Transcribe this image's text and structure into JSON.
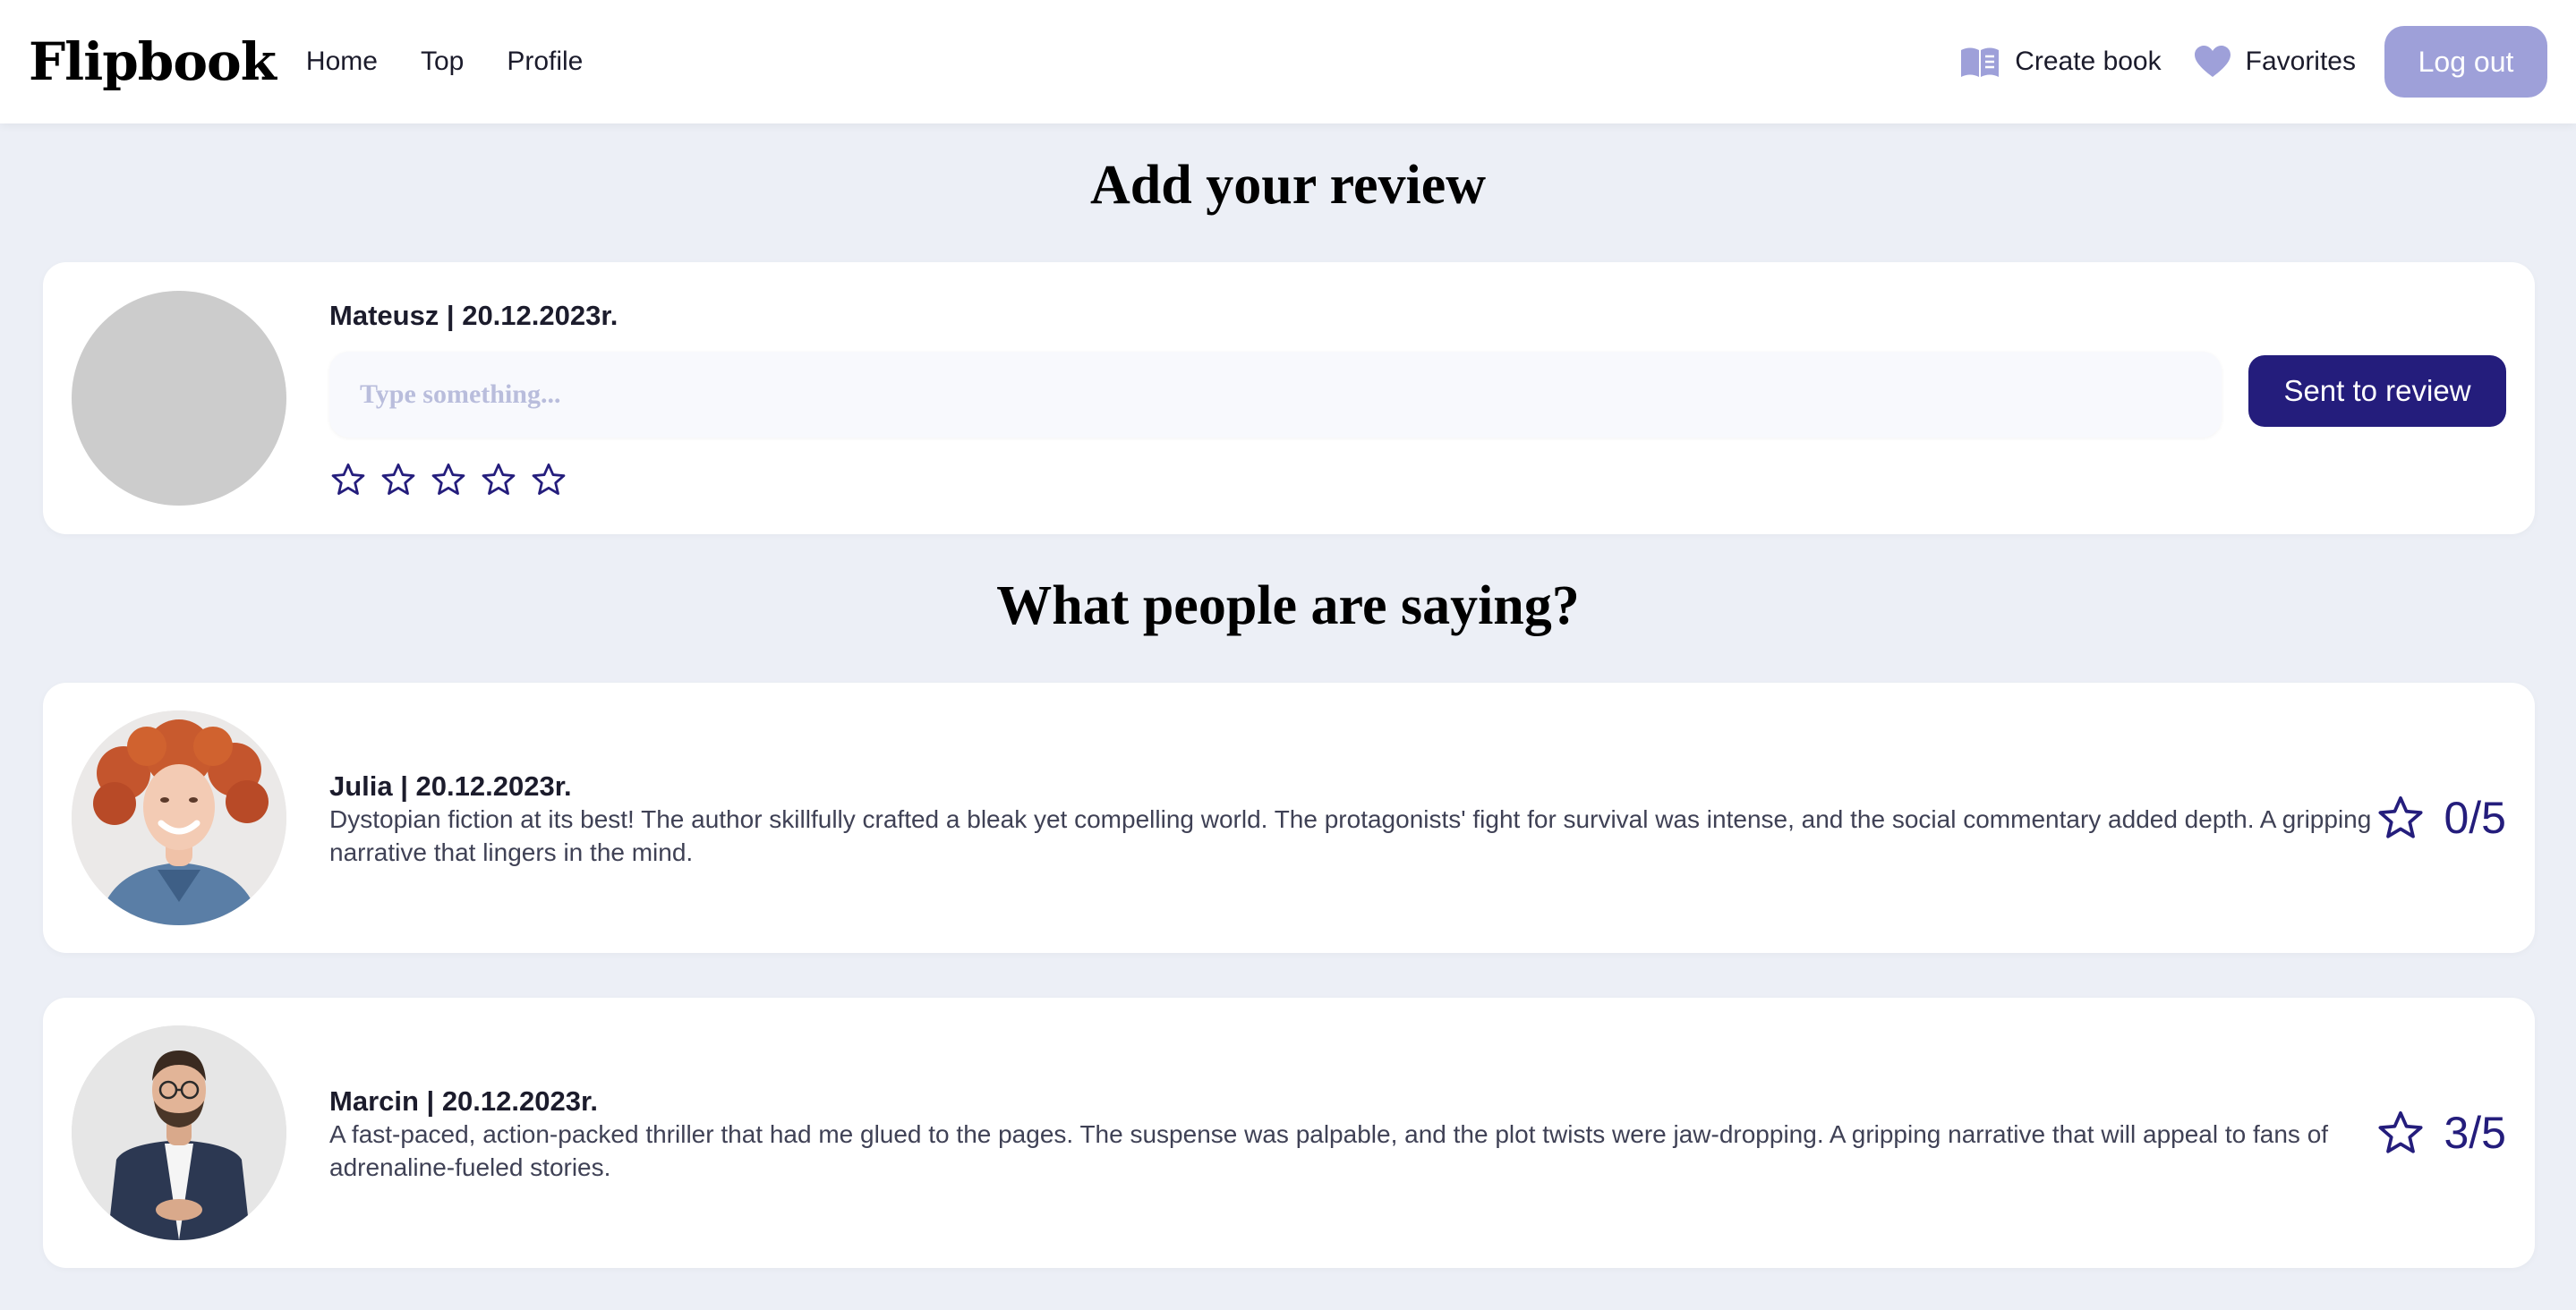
{
  "nav": {
    "logo": "Flipbook",
    "links": [
      "Home",
      "Top",
      "Profile"
    ],
    "create_book": "Create book",
    "favorites": "Favorites",
    "logout": "Log out",
    "icons": {
      "create_book": "open-book-icon",
      "favorites": "heart-icon"
    }
  },
  "add_review": {
    "title": "Add your review",
    "author_line": "Mateusz | 20.12.2023r.",
    "input_placeholder": "Type something...",
    "input_value": "",
    "star_count": 5,
    "selected_stars": 0,
    "submit_label": "Sent to review"
  },
  "reviews_title": "What people are saying?",
  "reviews": [
    {
      "author_line": "Julia | 20.12.2023r.",
      "text": "Dystopian fiction at its best! The author skillfully crafted a bleak yet compelling world. The protagonists' fight for survival was intense, and the social commentary added depth. A gripping narrative that lingers in the mind.",
      "rating": "0/5",
      "avatar": "woman-with-red-curly-hair-photo"
    },
    {
      "author_line": "Marcin | 20.12.2023r.",
      "text": "A fast-paced, action-packed thriller that had me glued to the pages. The suspense was palpable, and the plot twists were jaw-dropping. A gripping narrative that will appeal to fans of adrenaline-fueled stories.",
      "rating": "3/5",
      "avatar": "man-with-glasses-and-beard-photo"
    }
  ],
  "colors": {
    "page_background": "#eceff6",
    "accent": "#241d7c",
    "logout_button": "#9ea0d9",
    "nav_icons": "#9ea0d9"
  }
}
